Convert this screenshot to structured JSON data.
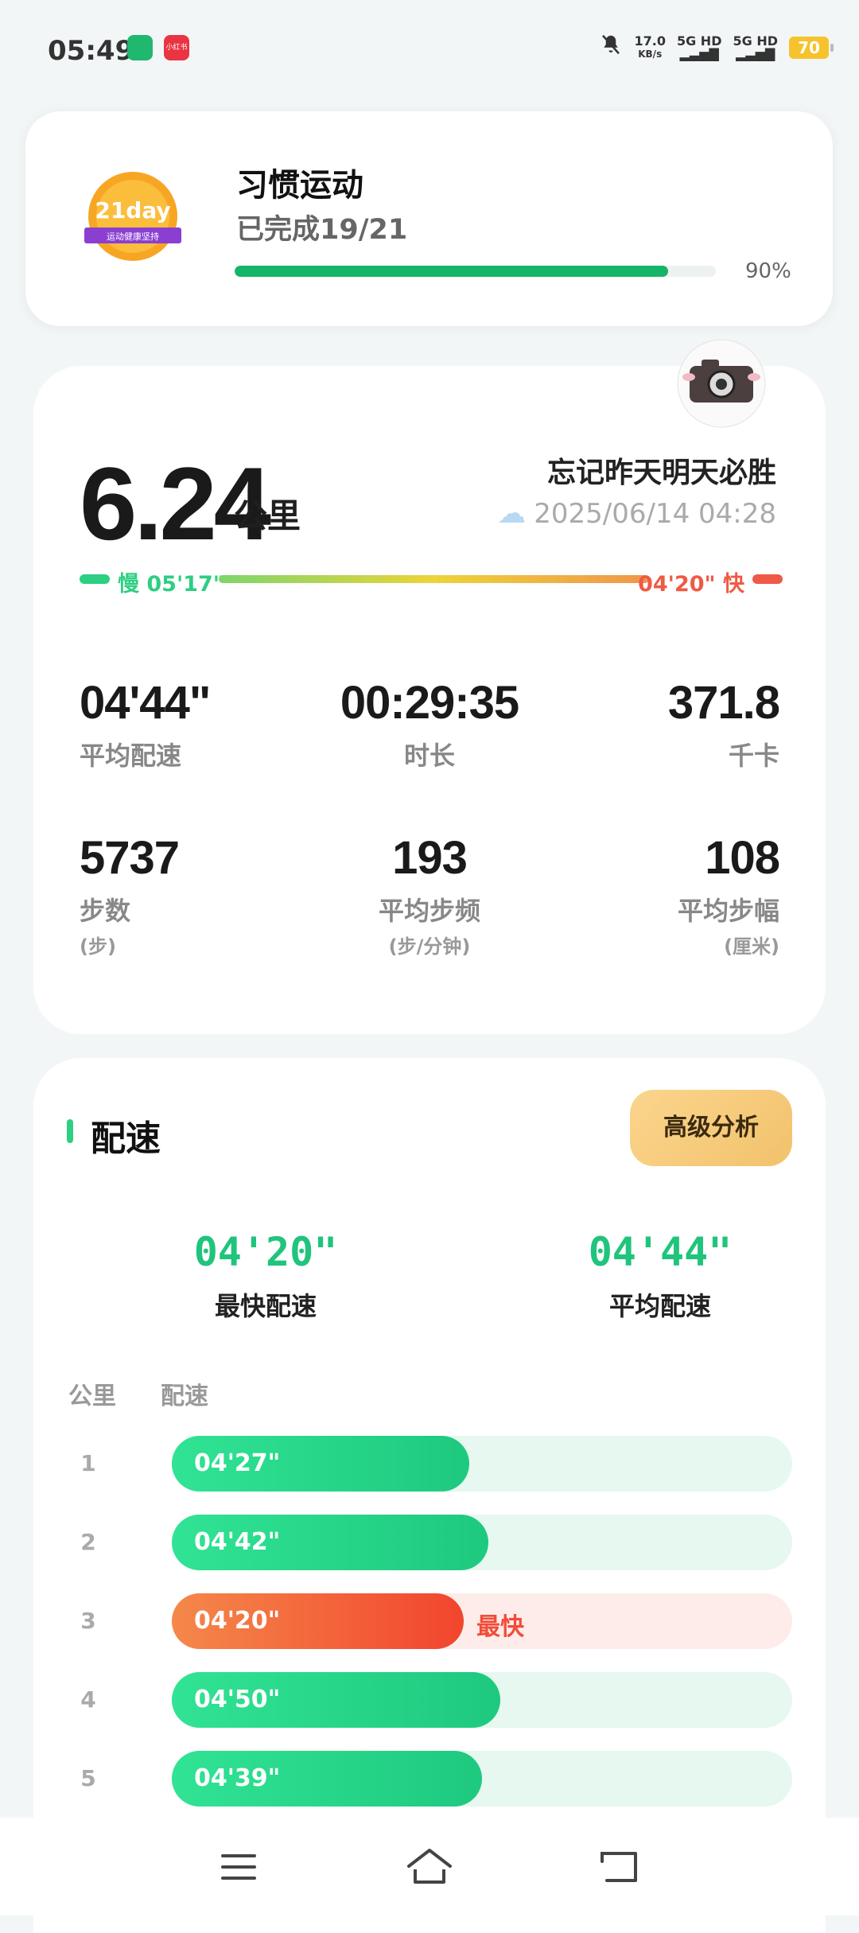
{
  "status_bar": {
    "time": "05:49",
    "net_speed_value": "17.0",
    "net_speed_unit": "KB/s",
    "signal1": "5G HD",
    "signal2": "5G HD",
    "battery": "70",
    "redbook_label": "小红书"
  },
  "habit": {
    "title": "习惯运动",
    "progress_text": "已完成19/21",
    "progress": 0.9,
    "percent_label": "90%",
    "badge_text": "21day",
    "badge_sub": "运动健康坚持"
  },
  "summary": {
    "distance": "6.24",
    "distance_unit": "公里",
    "slogan": "忘记昨天明天必胜",
    "datetime": "2025/06/14 04:28",
    "pace_slow_label": "慢 05'17\"",
    "pace_fast_label": "04'20\" 快"
  },
  "metrics": [
    {
      "value": "04'44\"",
      "label": "平均配速",
      "sub": ""
    },
    {
      "value": "00:29:35",
      "label": "时长",
      "sub": ""
    },
    {
      "value": "371.8",
      "label": "千卡",
      "sub": ""
    },
    {
      "value": "5737",
      "label": "步数",
      "sub": "(步)"
    },
    {
      "value": "193",
      "label": "平均步频",
      "sub": "(步/分钟)"
    },
    {
      "value": "108",
      "label": "平均步幅",
      "sub": "(厘米)"
    }
  ],
  "pace_section": {
    "title": "配速",
    "advanced_button": "高级分析",
    "fastest_value": "04'20\"",
    "fastest_label": "最快配速",
    "average_value": "04'44\"",
    "average_label": "平均配速",
    "col_km": "公里",
    "col_pace": "配速",
    "fastest_tag": "最快",
    "splits": [
      {
        "km": "1",
        "pace": "04'27\"",
        "fraction": 0.48,
        "fastest": false
      },
      {
        "km": "2",
        "pace": "04'42\"",
        "fraction": 0.51,
        "fastest": false
      },
      {
        "km": "3",
        "pace": "04'20\"",
        "fraction": 0.47,
        "fastest": true
      },
      {
        "km": "4",
        "pace": "04'50\"",
        "fraction": 0.53,
        "fastest": false
      },
      {
        "km": "5",
        "pace": "04'39\"",
        "fraction": 0.5,
        "fastest": false
      }
    ]
  },
  "colors": {
    "accent_green": "#20c47c",
    "fast_red": "#f04c39"
  }
}
